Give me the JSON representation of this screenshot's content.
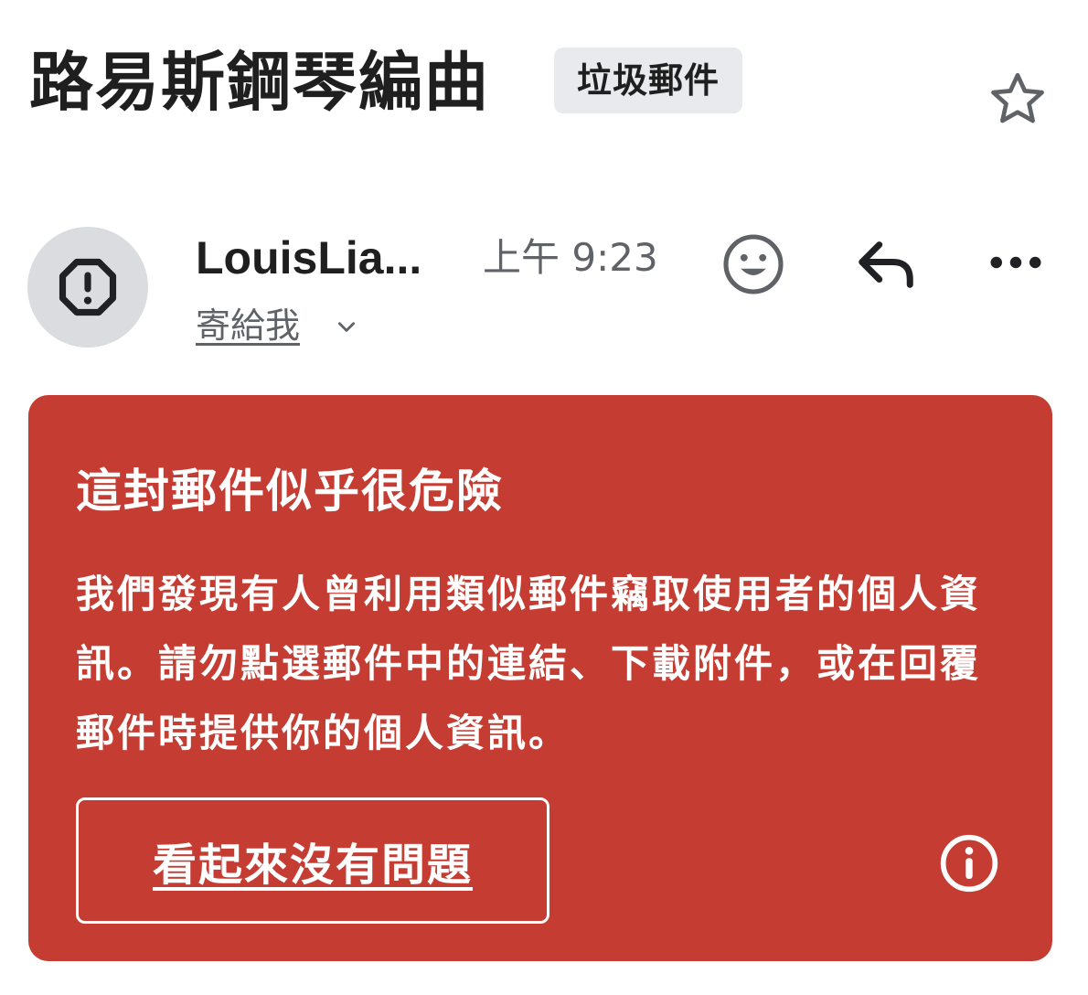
{
  "email": {
    "subject": "路易斯鋼琴編曲",
    "label": "垃圾郵件",
    "sender_name": "LouisLia...",
    "time": "上午 9:23",
    "recipient": "寄給我"
  },
  "icons": {
    "star": "star-outline-icon",
    "avatar": "octagon-alert-icon",
    "react": "emoji-smile-icon",
    "reply": "reply-arrow-icon",
    "more": "more-horizontal-icon",
    "expand": "chevron-down-icon",
    "info": "info-circle-icon"
  },
  "warning": {
    "title": "這封郵件似乎很危險",
    "body": "我們發現有人曾利用類似郵件竊取使用者的個人資訊。請勿點選郵件中的連結、下載附件，或在回覆郵件時提供你的個人資訊。",
    "button_label": "看起來沒有問題"
  },
  "colors": {
    "warning_bg": "#c53d32",
    "chip_bg": "#e8eaed",
    "avatar_bg": "#dadce0",
    "secondary_text": "#5f6368",
    "icon_gray": "#5f6368"
  }
}
